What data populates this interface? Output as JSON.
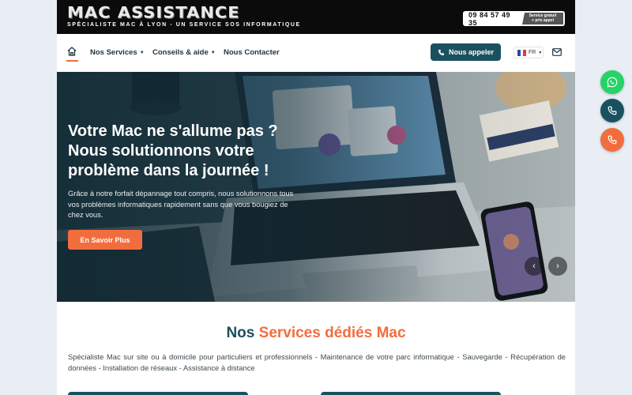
{
  "brand": {
    "title": "MAC ASSISTANCE",
    "subtitle": "SPÉCIALISTE MAC À LYON - UN SERVICE SOS INFORMATIQUE"
  },
  "header": {
    "phone": "09 84 57 49 35",
    "phone_badge_line1": "Service gratuit",
    "phone_badge_line2": "+ prix appel"
  },
  "nav": {
    "items": [
      {
        "label": "Nos Services",
        "dropdown": true
      },
      {
        "label": "Conseils & aide",
        "dropdown": true
      },
      {
        "label": "Nous Contacter",
        "dropdown": false
      }
    ],
    "call_button": "Nous appeler",
    "language": "FR"
  },
  "hero": {
    "title_lines": [
      "Votre Mac ne s'allume pas ?",
      "Nous solutionnons votre",
      "problème dans la journée !"
    ],
    "text": "Grâce à notre forfait dépannage tout compris, nous solutionnons tous vos problèmes informatiques rapidement sans que vous bougiez de chez vous.",
    "button": "En Savoir Plus",
    "prev_icon": "chevron-left-icon",
    "next_icon": "chevron-right-icon"
  },
  "services": {
    "title_part1": "Nos ",
    "title_part2": "Services dédiés Mac",
    "text": "Spécialiste Mac sur site ou à domicile pour particuliers et professionnels - Maintenance de votre parc informatique - Sauvegarde - Récupération de données - Installation de réseaux - Assistance à distance"
  },
  "floating": [
    {
      "icon": "whatsapp-icon",
      "color": "#25d366"
    },
    {
      "icon": "phone-icon",
      "color": "#1a5160"
    },
    {
      "icon": "phone-icon",
      "color": "#f26d3d"
    }
  ],
  "colors": {
    "accent": "#f26d3d",
    "primary": "#1a5160",
    "dark": "#0b0b0b"
  }
}
